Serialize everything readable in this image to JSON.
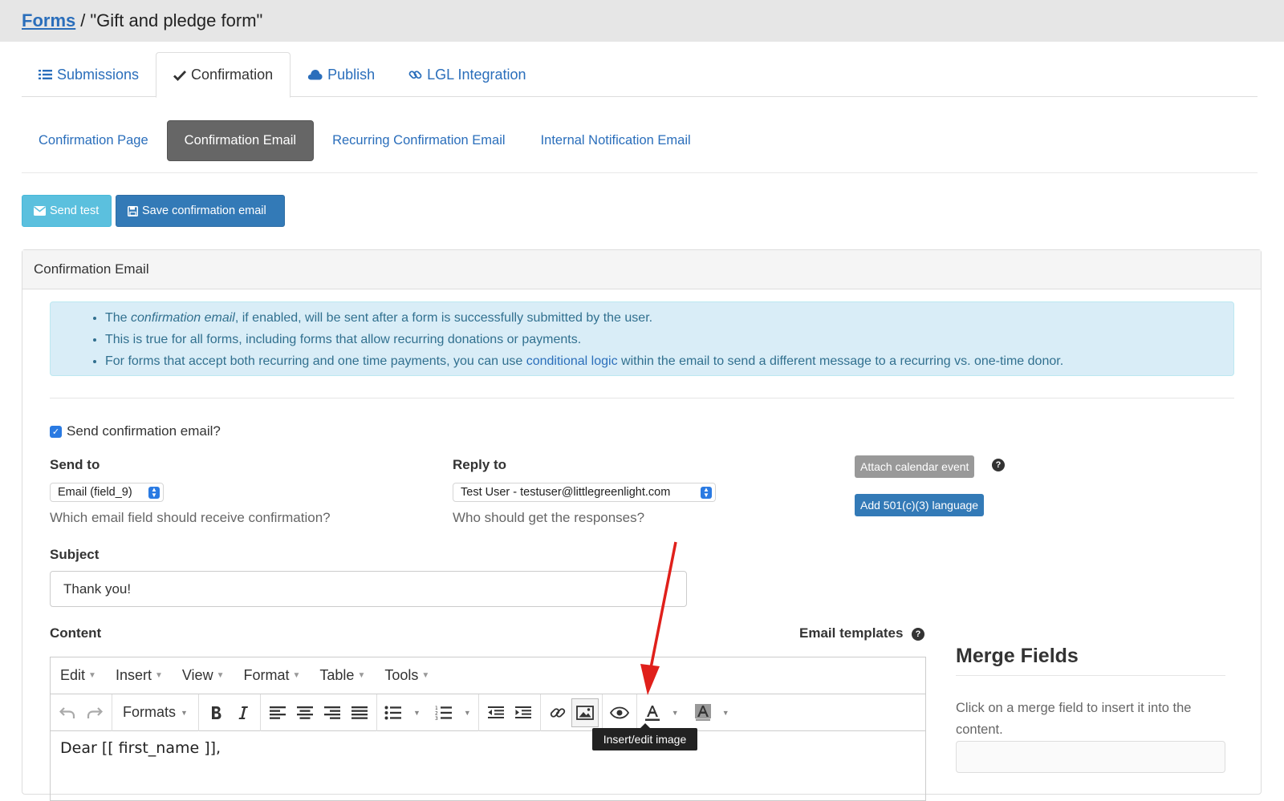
{
  "breadcrumb": {
    "root": "Forms",
    "separator": "/",
    "current": "\"Gift and pledge form\""
  },
  "tabs": [
    {
      "label": "Submissions",
      "icon": "list-icon"
    },
    {
      "label": "Confirmation",
      "icon": "check-icon",
      "active": true
    },
    {
      "label": "Publish",
      "icon": "cloud-icon"
    },
    {
      "label": "LGL Integration",
      "icon": "link-icon"
    }
  ],
  "subtabs": [
    {
      "label": "Confirmation Page"
    },
    {
      "label": "Confirmation Email",
      "active": true
    },
    {
      "label": "Recurring Confirmation Email"
    },
    {
      "label": "Internal Notification Email"
    }
  ],
  "actions": {
    "send_test": "Send test",
    "save": "Save confirmation email"
  },
  "panel": {
    "title": "Confirmation Email",
    "info": {
      "line1_pre": "The ",
      "line1_em": "confirmation email",
      "line1_post": ", if enabled, will be sent after a form is successfully submitted by the user.",
      "line2": "This is true for all forms, including forms that allow recurring donations or payments.",
      "line3_pre": "For forms that accept both recurring and one time payments, you can use ",
      "line3_link": "conditional logic",
      "line3_post": " within the email to send a different message to a recurring vs. one-time donor."
    },
    "send_checkbox": {
      "label": "Send confirmation email?",
      "checked": true
    },
    "send_to": {
      "label": "Send to",
      "value": "Email (field_9)",
      "help": "Which email field should receive confirmation?"
    },
    "reply_to": {
      "label": "Reply to",
      "value": "Test User - testuser@littlegreenlight.com",
      "help": "Who should get the responses?"
    },
    "attach_calendar": "Attach calendar event",
    "add_501c3": "Add 501(c)(3) language",
    "subject": {
      "label": "Subject",
      "value": "Thank you!"
    },
    "content": {
      "label": "Content",
      "templates_label": "Email templates"
    }
  },
  "editor": {
    "menus": [
      "Edit",
      "Insert",
      "View",
      "Format",
      "Table",
      "Tools"
    ],
    "formats_label": "Formats",
    "body_text": "Dear [[ first_name ]],",
    "tooltip": "Insert/edit image"
  },
  "merge_fields": {
    "title": "Merge Fields",
    "help": "Click on a merge field to insert it into the content."
  },
  "colors": {
    "link": "#2a6ebb",
    "primary": "#337ab7",
    "info": "#5bc0de",
    "annotation_arrow": "#e0201b"
  }
}
